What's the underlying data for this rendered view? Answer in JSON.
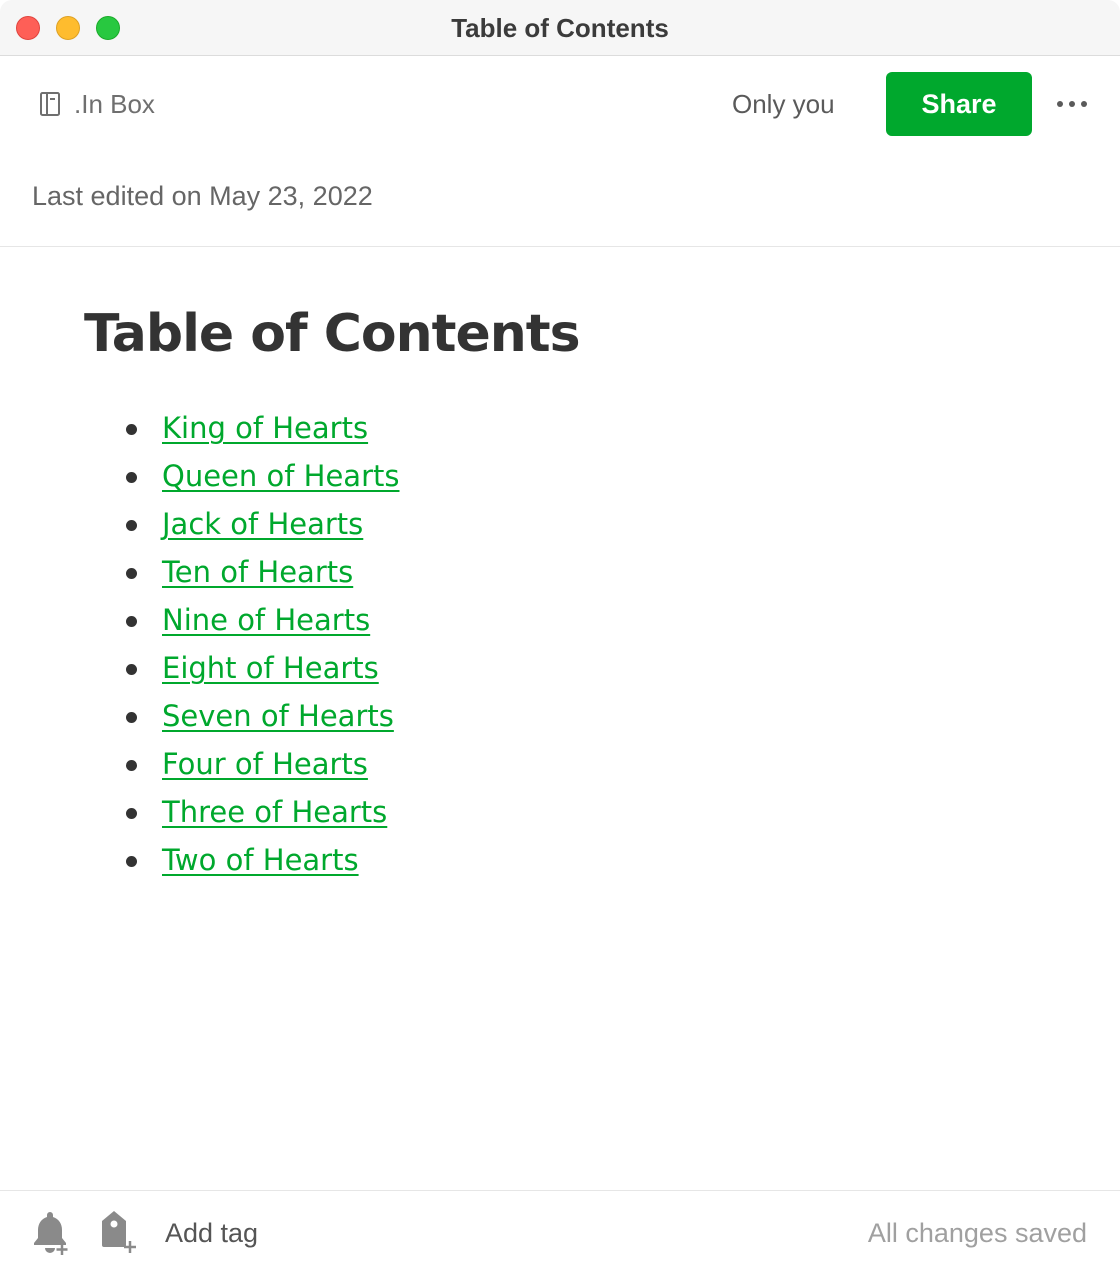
{
  "window": {
    "title": "Table of Contents",
    "traffic_lights": {
      "close": "#fe5f57",
      "minimize": "#febc2e",
      "zoom": "#28c840"
    }
  },
  "header": {
    "notebook_icon": "notebook-icon",
    "notebook_name": ".In Box",
    "sharing_status": "Only you",
    "share_label": "Share",
    "more_icon": "more-horizontal-icon",
    "last_edited": "Last edited on May 23, 2022"
  },
  "note": {
    "title": "Table of Contents",
    "links": [
      {
        "label": "King of Hearts"
      },
      {
        "label": "Queen of Hearts"
      },
      {
        "label": "Jack of Hearts"
      },
      {
        "label": "Ten of Hearts"
      },
      {
        "label": "Nine of Hearts"
      },
      {
        "label": "Eight of Hearts"
      },
      {
        "label": "Seven of Hearts"
      },
      {
        "label": "Four of Hearts"
      },
      {
        "label": "Three of Hearts"
      },
      {
        "label": "Two of Hearts"
      }
    ]
  },
  "footer": {
    "reminder_icon": "add-reminder-bell-icon",
    "tag_icon": "add-tag-icon",
    "add_tag_label": "Add tag",
    "save_status": "All changes saved"
  },
  "colors": {
    "accent": "#00a82d",
    "text": "#333333",
    "muted": "#a0a0a0"
  }
}
